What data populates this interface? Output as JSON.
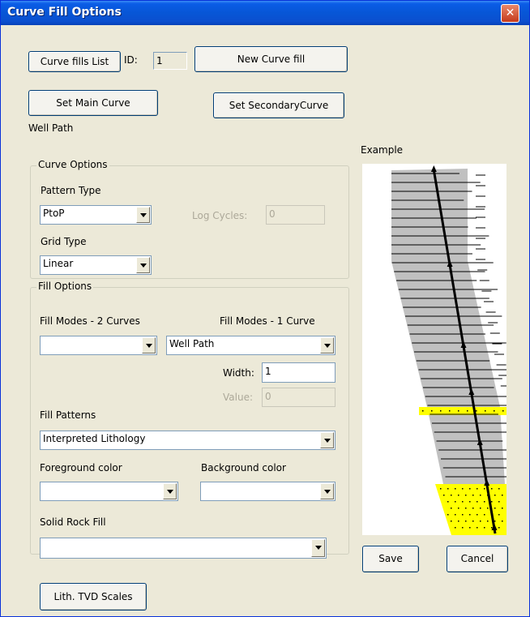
{
  "window": {
    "title": "Curve Fill Options"
  },
  "top": {
    "curve_fills_list": "Curve fills List",
    "id_label": "ID:",
    "id_value": "1",
    "new_curve_fill": "New Curve fill",
    "set_main_curve": "Set Main Curve",
    "set_secondary_curve": "Set SecondaryCurve",
    "main_curve_name": "Well Path"
  },
  "curve_options": {
    "title": "Curve Options",
    "pattern_type_label": "Pattern Type",
    "pattern_type_value": "PtoP",
    "log_cycles_label": "Log Cycles:",
    "log_cycles_value": "0",
    "grid_type_label": "Grid Type",
    "grid_type_value": "Linear"
  },
  "fill_options": {
    "title": "Fill Options",
    "modes_2_label": "Fill Modes - 2 Curves",
    "modes_2_value": "",
    "modes_1_label": "Fill Modes - 1 Curve",
    "modes_1_value": "Well Path",
    "width_label": "Width:",
    "width_value": "1",
    "value_label": "Value:",
    "value_value": "0",
    "patterns_label": "Fill Patterns",
    "patterns_value": "Interpreted Lithology",
    "fg_label": "Foreground color",
    "fg_value": "",
    "bg_label": "Background color",
    "bg_value": "",
    "solid_label": "Solid Rock Fill",
    "solid_value": ""
  },
  "example": {
    "label": "Example"
  },
  "buttons": {
    "save": "Save",
    "cancel": "Cancel",
    "lith_tvd": "Lith. TVD Scales"
  },
  "colors": {
    "fill_gray": "#c0c0c0",
    "fill_yellow": "#ffff00",
    "titlebar": "#0756d6"
  }
}
